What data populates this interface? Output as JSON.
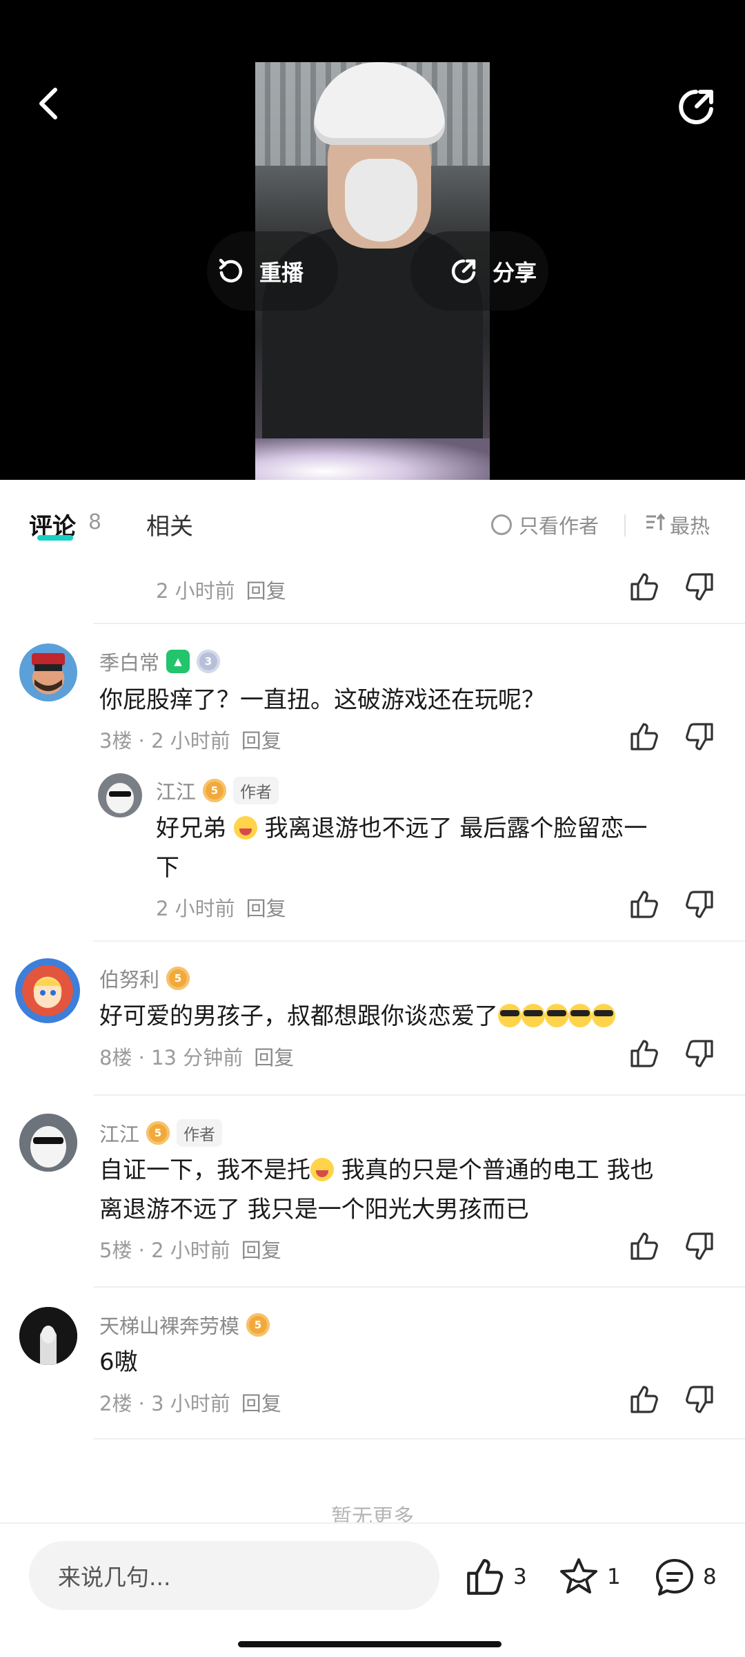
{
  "video": {
    "replay_label": "重播",
    "share_label": "分享"
  },
  "tabs": {
    "comments_label": "评论",
    "comments_count": "8",
    "related_label": "相关",
    "author_only_label": "只看作者",
    "sort_label": "最热"
  },
  "comments": {
    "top_partial": {
      "time": "2 小时前",
      "reply": "回复"
    },
    "c1": {
      "user": "季白常",
      "text": "你屁股痒了？一直扭。这破游戏还在玩呢？",
      "floor_time": "3楼 · 2 小时前",
      "reply": "回复",
      "badge_level": "3"
    },
    "c1_reply": {
      "user": "江江",
      "author_tag": "作者",
      "text_a": "好兄弟 ",
      "text_b": " 我离退游也不远了 最后露个脸留恋一",
      "text_c": "下",
      "time": "2 小时前",
      "reply": "回复",
      "badge_level": "5"
    },
    "c2": {
      "user": "伯努利",
      "text": "好可爱的男孩子，叔都想跟你谈恋爱了",
      "floor_time": "8楼 · 13 分钟前",
      "reply": "回复",
      "badge_level": "5"
    },
    "c3": {
      "user": "江江",
      "author_tag": "作者",
      "text_a": "自证一下，我不是托",
      "text_b": " 我真的只是个普通的电工  我也",
      "text_c": "离退游不远了  我只是一个阳光大男孩而已",
      "floor_time": "5楼 · 2 小时前",
      "reply": "回复",
      "badge_level": "5"
    },
    "c4": {
      "user": "天梯山裸奔劳模",
      "text": "6嗷",
      "floor_time": "2楼 · 3 小时前",
      "reply": "回复",
      "badge_level": "5"
    }
  },
  "no_more": "暂无更多",
  "bottom_bar": {
    "input_placeholder": "来说几句...",
    "like_count": "3",
    "favorite_count": "1",
    "comment_count": "8"
  },
  "colors": {
    "accent": "#18d0c4",
    "badge_orange": "#f2a93b",
    "text_muted": "#9a9a9a"
  }
}
